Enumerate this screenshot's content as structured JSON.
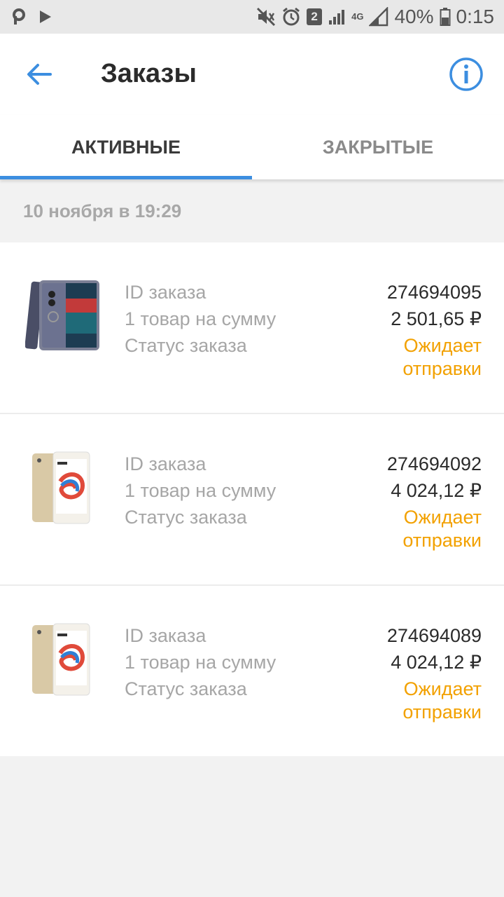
{
  "status_bar": {
    "sim_badge": "2",
    "network": "4G",
    "battery": "40%",
    "time": "0:15"
  },
  "appbar": {
    "title": "Заказы"
  },
  "tabs": [
    {
      "label": "АКТИВНЫЕ",
      "active": true
    },
    {
      "label": "ЗАКРЫТЫЕ",
      "active": false
    }
  ],
  "date_header": "10 ноября в 19:29",
  "order_labels": {
    "id": "ID заказа",
    "sum": "1 товар на сумму",
    "status": "Статус заказа"
  },
  "orders": [
    {
      "id": "274694095",
      "sum": "2 501,65 ₽",
      "status": "Ожидает отправки",
      "phone": "dark"
    },
    {
      "id": "274694092",
      "sum": "4 024,12 ₽",
      "status": "Ожидает отправки",
      "phone": "gold"
    },
    {
      "id": "274694089",
      "sum": "4 024,12 ₽",
      "status": "Ожидает отправки",
      "phone": "gold"
    }
  ],
  "colors": {
    "accent": "#3c8ee0",
    "status": "#f2a100",
    "background": "#f2f2f2"
  }
}
